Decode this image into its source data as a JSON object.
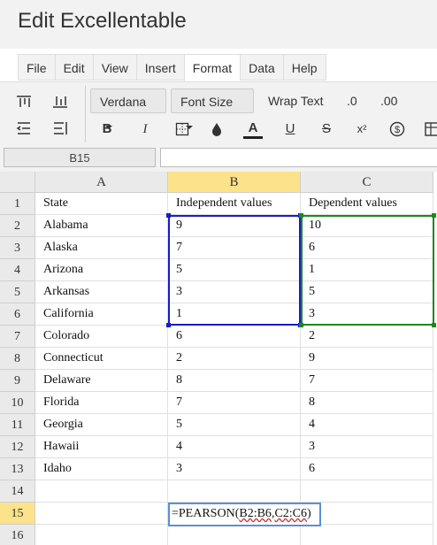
{
  "app": {
    "title": "Edit Excellentable"
  },
  "menu": {
    "tabs": [
      {
        "label": "File"
      },
      {
        "label": "Edit"
      },
      {
        "label": "View"
      },
      {
        "label": "Insert"
      },
      {
        "label": "Format",
        "active": true
      },
      {
        "label": "Data"
      },
      {
        "label": "Help"
      }
    ]
  },
  "toolbar": {
    "font_family": "Verdana",
    "font_size": "Font Size",
    "wrap_text": "Wrap Text",
    "decrease_decimal": ".0",
    "increase_decimal": ".00",
    "bold": "B",
    "italic": "I",
    "underline": "U",
    "strikethrough": "S",
    "superscript": "x²",
    "font_color": "A"
  },
  "formula_bar": {
    "cell_ref": "B15",
    "value": ""
  },
  "sheet": {
    "columns": [
      "A",
      "B",
      "C"
    ],
    "selected_column": "B",
    "selected_row": "15",
    "rows": [
      {
        "num": "1",
        "cells": [
          "State",
          "Independent values",
          "Dependent values"
        ]
      },
      {
        "num": "2",
        "cells": [
          "Alabama",
          "9",
          "10"
        ]
      },
      {
        "num": "3",
        "cells": [
          "Alaska",
          "7",
          "6"
        ]
      },
      {
        "num": "4",
        "cells": [
          "Arizona",
          "5",
          "1"
        ]
      },
      {
        "num": "5",
        "cells": [
          "Arkansas",
          "3",
          "5"
        ]
      },
      {
        "num": "6",
        "cells": [
          "California",
          "1",
          "3"
        ]
      },
      {
        "num": "7",
        "cells": [
          "Colorado",
          "6",
          "2"
        ]
      },
      {
        "num": "8",
        "cells": [
          "Connecticut",
          "2",
          "9"
        ]
      },
      {
        "num": "9",
        "cells": [
          "Delaware",
          "8",
          "7"
        ]
      },
      {
        "num": "10",
        "cells": [
          "Florida",
          "7",
          "8"
        ]
      },
      {
        "num": "11",
        "cells": [
          "Georgia",
          "5",
          "4"
        ]
      },
      {
        "num": "12",
        "cells": [
          "Hawaii",
          "4",
          "3"
        ]
      },
      {
        "num": "13",
        "cells": [
          "Idaho",
          "3",
          "6"
        ]
      },
      {
        "num": "14",
        "cells": [
          "",
          "",
          ""
        ]
      },
      {
        "num": "15",
        "cells": [
          "",
          "",
          ""
        ]
      },
      {
        "num": "16",
        "cells": [
          "",
          "",
          ""
        ]
      }
    ],
    "editor": {
      "prefix": "=PEARSON(",
      "ref1": "B2:B6",
      "sep": ",",
      "ref2": "C2:C6",
      "suffix": ")"
    },
    "colors": {
      "range1": "#1a1acd",
      "range2": "#1a8a1a",
      "selected_header": "#fce28a"
    }
  }
}
